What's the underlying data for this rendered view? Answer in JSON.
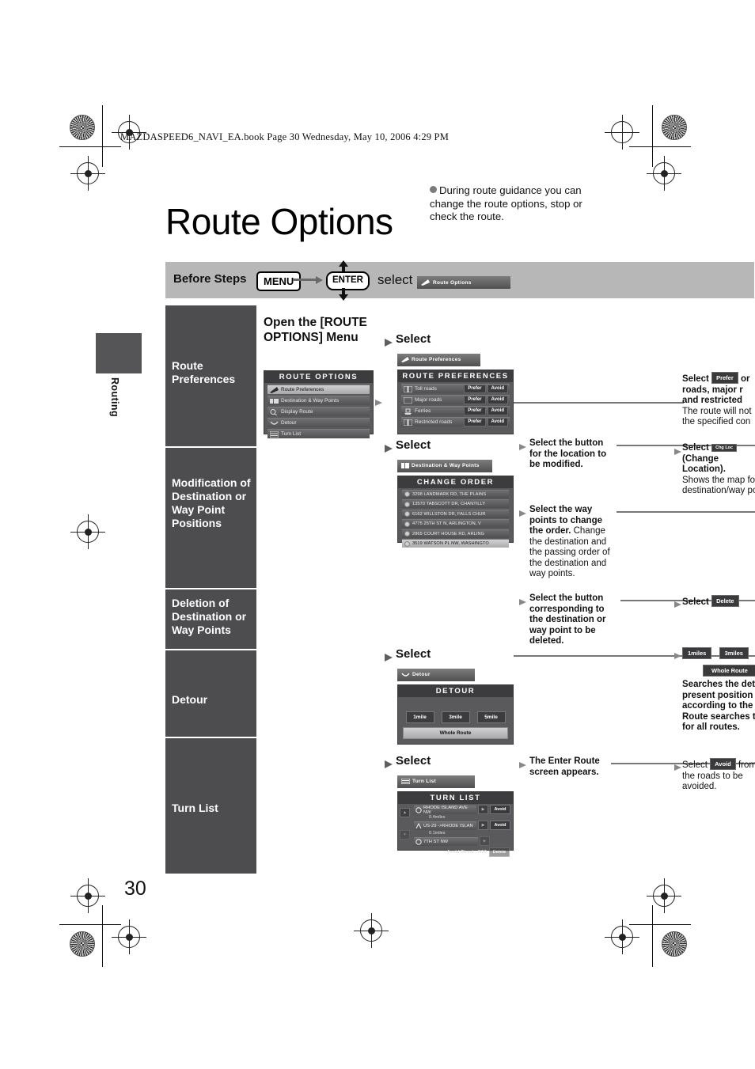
{
  "print": {
    "book_line": "MAZDASPEED6_NAVI_EA.book  Page 30  Wednesday, May 10, 2006  4:29 PM",
    "page_number": "30"
  },
  "title": "Route Options",
  "intro": "During route guidance you can change the route options, stop or check the route.",
  "before_steps": {
    "label": "Before Steps",
    "key_menu": "MENU",
    "key_enter": "ENTER",
    "select_word": "select",
    "chip": "Route Options"
  },
  "tab": {
    "label": "Routing"
  },
  "sidebar": {
    "items": [
      {
        "label": "Route Preferences"
      },
      {
        "label": "Modification of Destination or Way Point Positions"
      },
      {
        "label": "Deletion of Destination or Way Points"
      },
      {
        "label": "Detour"
      },
      {
        "label": "Turn List"
      }
    ]
  },
  "open_menu_heading": "Open the [ROUTE OPTIONS] Menu",
  "route_options_screen": {
    "title": "ROUTE OPTIONS",
    "items": [
      {
        "label": "Route Preferences",
        "icon": "flag-icon",
        "selected": true
      },
      {
        "label": "Destination & Way Points",
        "icon": "waypoints-icon",
        "selected": false
      },
      {
        "label": "Display Route",
        "icon": "magnifier-icon",
        "selected": false
      },
      {
        "label": "Detour",
        "icon": "detour-icon",
        "selected": false
      },
      {
        "label": "Turn List",
        "icon": "list-icon",
        "selected": false
      }
    ]
  },
  "steps": [
    {
      "select_label": "Select",
      "chip": "Route Preferences",
      "screen_title": "ROUTE PREFERENCES",
      "rows": [
        {
          "label": "Toll roads",
          "prefer": "Prefer",
          "avoid": "Avoid"
        },
        {
          "label": "Major roads",
          "prefer": "Prefer",
          "avoid": "Avoid"
        },
        {
          "label": "Ferries",
          "prefer": "Prefer",
          "avoid": "Avoid"
        },
        {
          "label": "Restricted roads",
          "prefer": "Prefer",
          "avoid": "Avoid"
        }
      ]
    },
    {
      "select_label": "Select",
      "chip": "Destination & Way Points",
      "screen_title": "CHANGE ORDER",
      "rows": [
        {
          "label": "3298 LANDMARK RD,  THE PLAINS"
        },
        {
          "label": "13570 TABSCOTT DR,  CHANTILLY"
        },
        {
          "label": "6162 WILLSTON DR,  FALLS CHUR"
        },
        {
          "label": "4775 25TH ST N,  ARLINGTON,  V"
        },
        {
          "label": "2865 COURT HOUSE RD,  ARLING"
        },
        {
          "label": "3519 WATSON PL NW,  WASHINGTO"
        }
      ]
    },
    {
      "select_label": "Select",
      "chip": "Detour",
      "screen_title": "DETOUR",
      "buttons": [
        "1mile",
        "3mile",
        "5mile"
      ],
      "wide_button": "Whole Route"
    },
    {
      "select_label": "Select",
      "chip": "Turn List",
      "screen_title": "TURN LIST",
      "rows": [
        {
          "street": "RHODE ISLAND AVE NW",
          "distance": "0.4miles",
          "avoid": "Avoid"
        },
        {
          "street": "US-29 ->RHODE ISLAN",
          "distance": "0.1miles",
          "avoid": "Avoid"
        },
        {
          "street": "7TH ST NW",
          "distance": "",
          "avoid": ""
        }
      ],
      "footer": "Avoid Street :   0/10",
      "delete_button": "Delete"
    }
  ],
  "mid_callouts": [
    {
      "bold": "Select the button for the location to be modified.",
      "normal": ""
    },
    {
      "bold": "Select the way points to change the order.",
      "normal": "Change the destination and the passing order of the destination and way points."
    },
    {
      "bold": "Select the button corresponding to the destination or way point to be deleted.",
      "normal": ""
    },
    {
      "bold": "The Enter Route screen appears.",
      "normal": ""
    }
  ],
  "right_callouts": [
    {
      "lead_bold": "Select",
      "chip": "Prefer",
      "bold_tail": "or",
      "bold_lines": [
        "roads, major r",
        "and restricted"
      ],
      "normal_lines": [
        "The route will not",
        "the specified con"
      ]
    },
    {
      "lead_bold": "Select",
      "chip": "Chg Loc",
      "bold_lines": [
        "(Change",
        "Location)."
      ],
      "normal_lines": [
        "Shows the map for",
        "destination/way po"
      ]
    },
    {
      "lead_bold": "Select",
      "chip": "Delete",
      "bold_lines": [],
      "normal_lines": []
    },
    {
      "buttons": [
        "1miles",
        "3miles"
      ],
      "wide_button": "Whole Route",
      "bold_lines": [
        "Searches the deto",
        "present position t",
        "according to the s",
        "Route searches th",
        "for all routes."
      ],
      "normal_lines": []
    },
    {
      "lead_normal": "Select",
      "chip": "Avoid",
      "normal_lines": [
        "from",
        "the roads to be",
        "avoided."
      ]
    }
  ],
  "colors": {
    "sidebar": "#4d4d4f",
    "steps_bar": "#b7b7b7",
    "screen_bg": "#5a5a5c",
    "screen_title": "#3c3c3e"
  }
}
